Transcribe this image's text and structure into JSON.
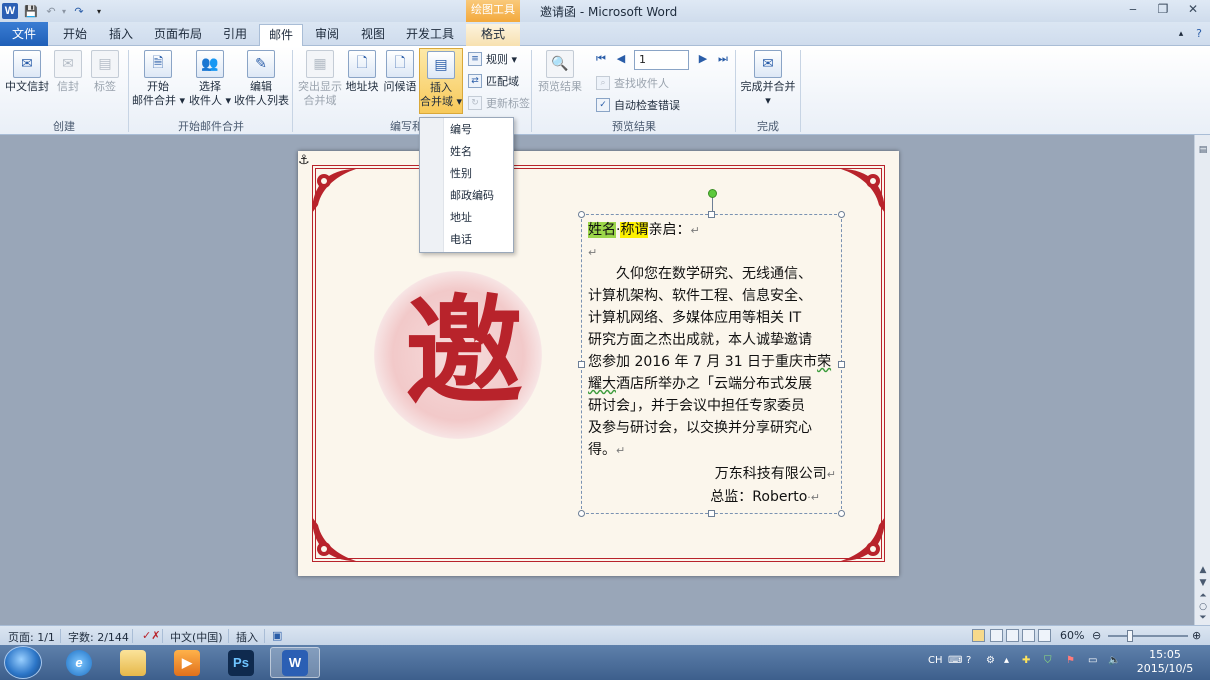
{
  "window": {
    "title": "邀请函 - Microsoft Word",
    "context_tab_group": "绘图工具",
    "minimize": "‒",
    "restore": "❐",
    "close": "✕"
  },
  "tabs": {
    "file": "文件",
    "items": [
      "开始",
      "插入",
      "页面布局",
      "引用",
      "邮件",
      "审阅",
      "视图",
      "开发工具"
    ],
    "active": "邮件",
    "context": "格式"
  },
  "ribbon": {
    "groups": {
      "create": "创建",
      "start_merge": "开始邮件合并",
      "write_insert": "编写和插",
      "preview": "预览结果",
      "finish": "完成"
    },
    "create": {
      "envelope": "中文信封",
      "envelopes": "信封",
      "labels": "标签"
    },
    "start_merge": {
      "start_1": "开始",
      "start_2": "邮件合并",
      "select_1": "选择",
      "select_2": "收件人",
      "edit_1": "编辑",
      "edit_2": "收件人列表"
    },
    "write_insert": {
      "highlight_1": "突出显示",
      "highlight_2": "合并域",
      "address_block": "地址块",
      "greeting": "问候语",
      "insert_1": "插入",
      "insert_2": "合并域",
      "rules": "规则",
      "match_fields": "匹配域",
      "update_labels": "更新标签"
    },
    "preview": {
      "preview_results": "预览结果",
      "record": "1",
      "find_recipient": "查找收件人",
      "auto_check": "自动检查错误"
    },
    "finish": {
      "finish_merge": "完成并合并"
    }
  },
  "dropdown": {
    "items": [
      "编号",
      "姓名",
      "性别",
      "邮政编码",
      "地址",
      "电话"
    ]
  },
  "document": {
    "seal_char": "邀",
    "field_name": "姓名",
    "field_title": "称谓",
    "greeting_suffix": "亲启：",
    "body_lines": [
      "　　久仰您在数学研究、无线通信、",
      "计算机架构、软件工程、信息安全、",
      "计算机网络、多媒体应用等相关 IT",
      "研究方面之杰出成就，本人诚挚邀请",
      "您参加 2016 年 7 月 31 日于重庆市",
      "酒店所举办之「云端分布式发展",
      "研讨会」，并于会议中担任专家委员",
      "及参与研讨会，以交换并分享研究心",
      "得。"
    ],
    "squiggle_word_1": "荣",
    "squiggle_word_2": "耀大",
    "signature_company": "万东科技有限公司",
    "signature_person": "总监：Roberto"
  },
  "statusbar": {
    "page": "页面: 1/1",
    "words": "字数: 2/144",
    "language": "中文(中国)",
    "mode": "插入",
    "zoom": "60%",
    "zoom_value": 60
  },
  "taskbar": {
    "apps": [
      "ie",
      "explorer",
      "media",
      "photoshop",
      "word"
    ],
    "ps_label": "Ps",
    "word_label": "W",
    "ime": "CH",
    "time": "15:05",
    "date": "2015/10/5"
  },
  "colors": {
    "accent_red": "#b8232b",
    "ribbon_blue": "#1f5fb8",
    "field_green": "#9bd64a",
    "field_yellow": "#fbf000"
  }
}
